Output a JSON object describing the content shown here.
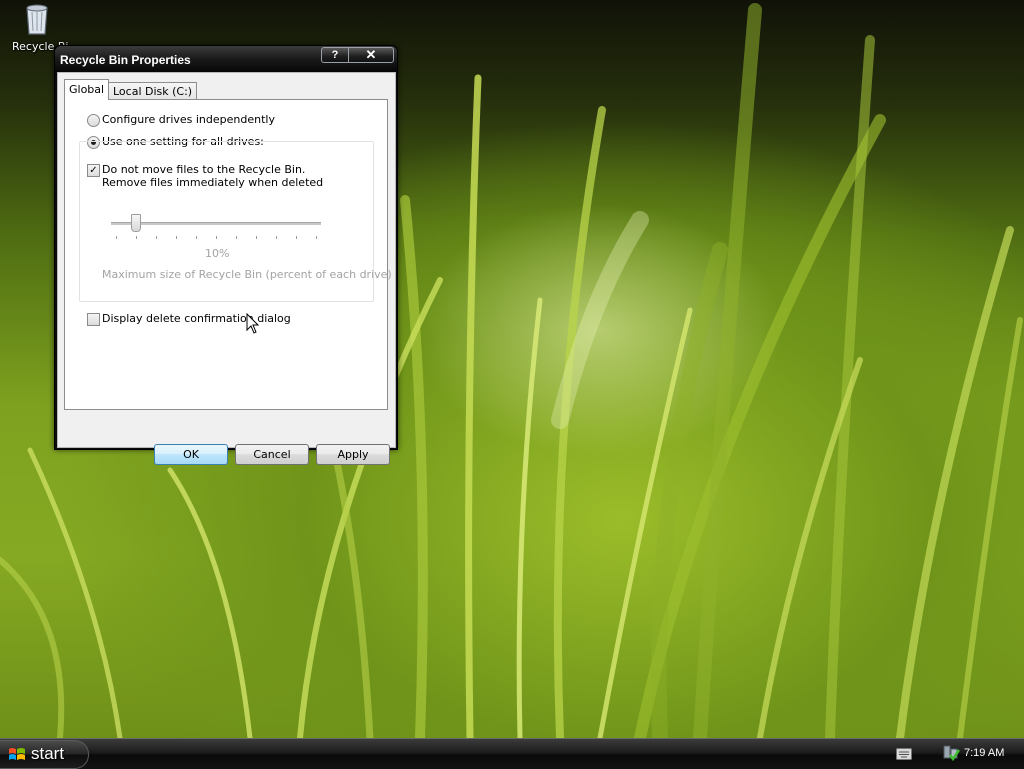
{
  "desktop": {
    "icons": [
      {
        "label": "Recycle Bi",
        "icon": "recycle-bin-icon"
      }
    ]
  },
  "dialog": {
    "title": "Recycle Bin Properties",
    "title_buttons": {
      "help": "?",
      "close": "✕"
    },
    "tabs": [
      {
        "label": "Global",
        "selected": true
      },
      {
        "label": "Local Disk (C:)",
        "selected": false
      }
    ],
    "options": {
      "configure_independently": {
        "label": "Configure drives independently",
        "selected": false
      },
      "one_setting": {
        "label": "Use one setting for all drives:",
        "selected": true
      }
    },
    "do_not_move": {
      "line1": "Do not move files to the Recycle Bin.",
      "line2": "Remove files immediately when deleted",
      "checked": true,
      "check_glyph": "✓"
    },
    "slider": {
      "value_label": "10%",
      "caption": "Maximum size of Recycle Bin (percent of each drive)",
      "value_percent": 10,
      "enabled": false
    },
    "confirm_dialog": {
      "label": "Display delete confirmation dialog",
      "checked": false
    },
    "buttons": {
      "ok": "OK",
      "cancel": "Cancel",
      "apply": "Apply"
    }
  },
  "taskbar": {
    "start_label": "start",
    "clock": "7:19 AM",
    "tray_icons": [
      "keyboard-icon",
      "network-icon"
    ]
  },
  "colors": {
    "wallpaper_green": "#7ea21f",
    "taskbar": "#1c1c1c",
    "ok_button_accent": "#3c7fb1"
  }
}
